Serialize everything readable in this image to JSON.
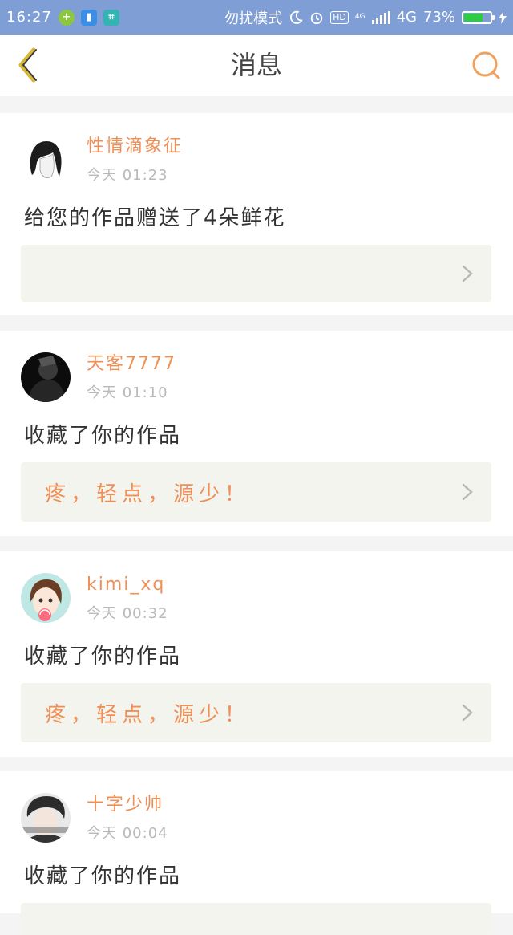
{
  "status_bar": {
    "time": "16:27",
    "mode_text": "勿扰模式",
    "hd": "HD",
    "network": "4G",
    "network_small": "4G",
    "battery": "73%",
    "battery_level": 0.73
  },
  "header": {
    "title": "消息",
    "back_icon": "chevron-left-icon",
    "search_icon": "search-icon"
  },
  "messages": [
    {
      "username": "性情滴象征",
      "time": "今天 01:23",
      "action": "给您的作品赠送了4朵鲜花",
      "work_title": ""
    },
    {
      "username": "天客7777",
      "time": "今天 01:10",
      "action": "收藏了你的作品",
      "work_title": "疼，轻点，源少！"
    },
    {
      "username": "kimi_xq",
      "time": "今天 00:32",
      "action": "收藏了你的作品",
      "work_title": "疼，轻点，源少！"
    },
    {
      "username": "十字少帅",
      "time": "今天 00:04",
      "action": "收藏了你的作品",
      "work_title": ""
    }
  ],
  "colors": {
    "accent": "#ef8f56",
    "status_bar": "#7f9ed6",
    "back_icon": "#d9b73a"
  }
}
